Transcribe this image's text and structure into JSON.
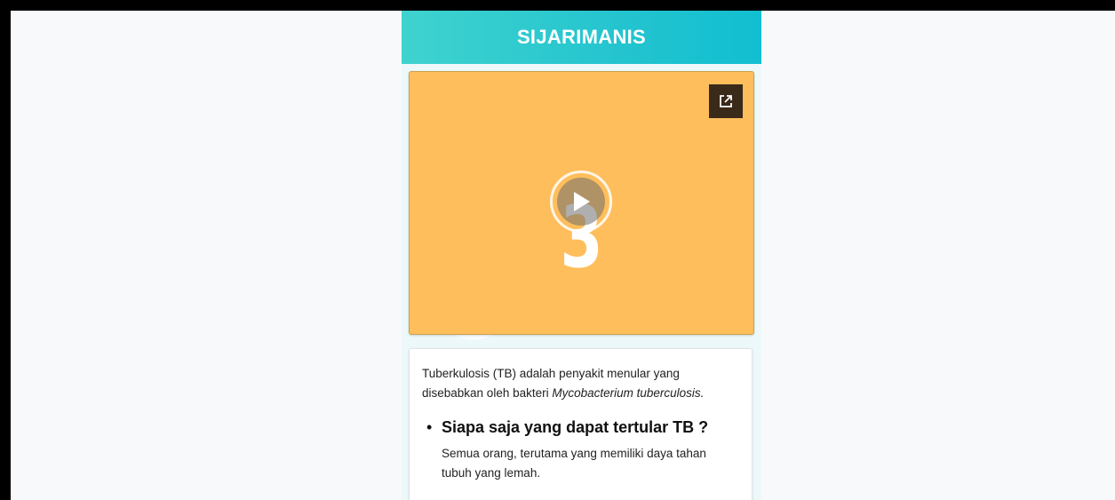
{
  "header": {
    "title": "SIJARIMANIS"
  },
  "video": {
    "countdown": "3",
    "play_icon": "play-icon",
    "external_icon": "external-link-icon",
    "background_color": "#ffbe5c"
  },
  "content": {
    "intro_prefix": "Tuberkulosis (TB) adalah penyakit menular yang disebabkan oleh bakteri ",
    "intro_italic": "Mycobacterium tuberculosis.",
    "faq": [
      {
        "question": "Siapa saja yang dapat tertular TB ?",
        "answer": "Semua orang, terutama yang memiliki daya tahan tubuh yang lemah."
      }
    ]
  },
  "colors": {
    "header_gradient_start": "#3fd3cf",
    "header_gradient_end": "#11bfd0"
  }
}
